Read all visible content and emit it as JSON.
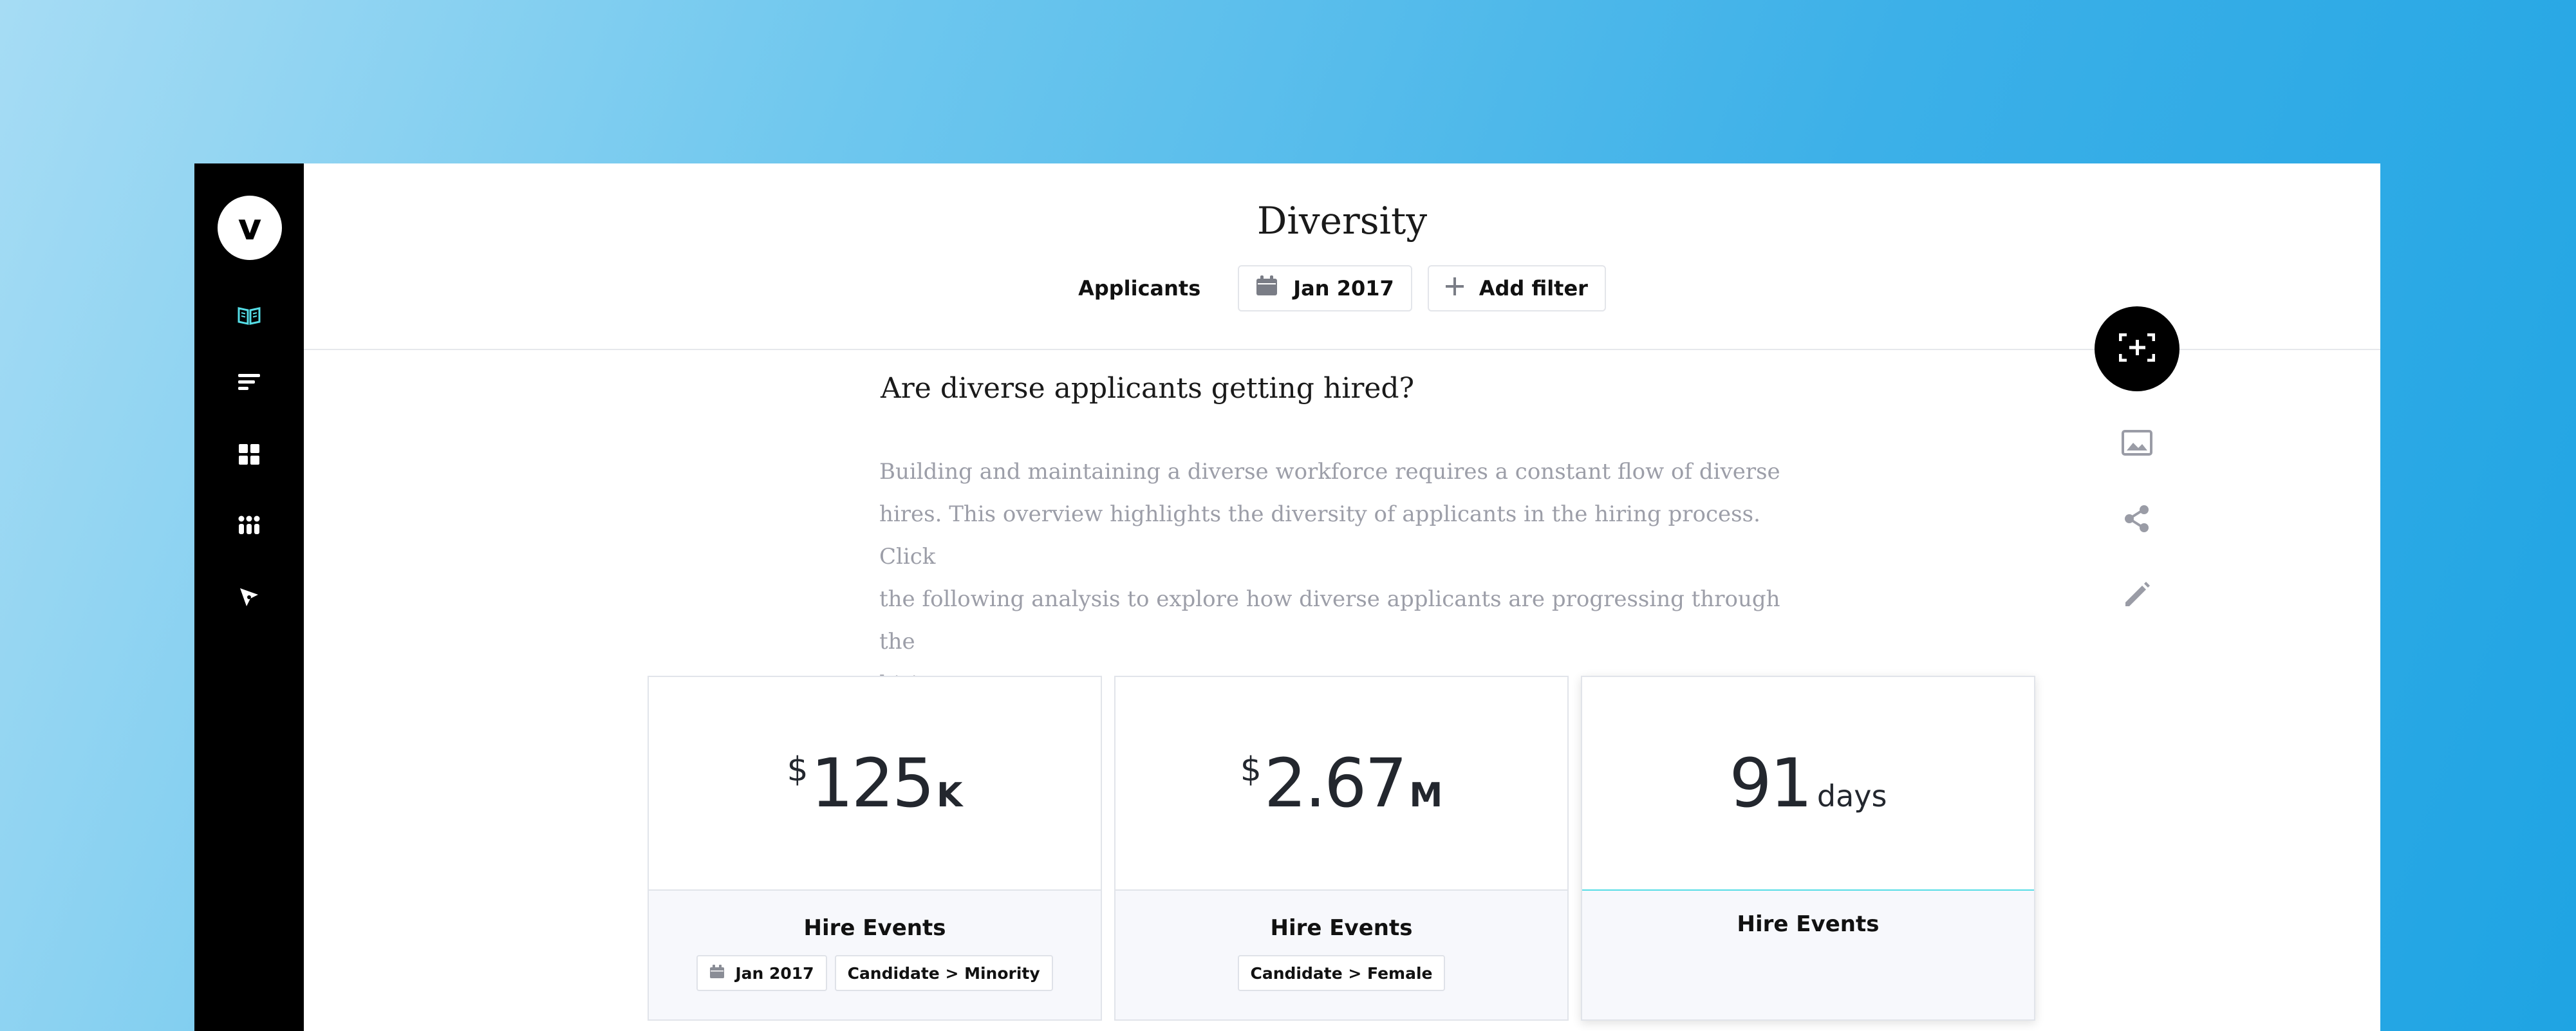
{
  "app": {
    "logo_letter": "v"
  },
  "sidebar": {
    "items": [
      {
        "icon": "book-open-icon",
        "active": true
      },
      {
        "icon": "sort-lines-icon"
      },
      {
        "icon": "grid-icon"
      },
      {
        "icon": "apps-dots-icon"
      },
      {
        "icon": "compass-icon"
      }
    ]
  },
  "header": {
    "title": "Diversity",
    "filter_label": "Applicants",
    "date_chip": "Jan 2017",
    "add_filter_label": "Add filter"
  },
  "content": {
    "question": "Are diverse applicants getting hired?",
    "description_lines": [
      "Building and maintaining a diverse workforce requires a constant flow of diverse",
      "hires. This overview highlights the diversity of applicants in the hiring process. Click",
      "the following analysis to explore how diverse applicants are progressing through the",
      "hiring process."
    ]
  },
  "actions": {
    "fab_icon": "add-frame-icon",
    "items": [
      "image-icon",
      "share-icon",
      "edit-pencil-icon"
    ]
  },
  "cards": [
    {
      "metric": {
        "prefix": "$",
        "value": "125",
        "suffix": "K"
      },
      "title": "Hire Events",
      "chips": [
        {
          "icon": "calendar-icon",
          "label": "Jan 2017"
        },
        {
          "label": "Candidate > Minority"
        }
      ]
    },
    {
      "metric": {
        "prefix": "$",
        "value": "2.67",
        "suffix": "M"
      },
      "title": "Hire Events",
      "chips": [
        {
          "label": "Candidate > Female"
        }
      ]
    },
    {
      "metric": {
        "prefix": "",
        "value": "91",
        "suffix": "days"
      },
      "title": "Hire Events",
      "chips": [],
      "active": true
    }
  ],
  "colors": {
    "accent": "#55dde6",
    "sidebar_bg": "#000000",
    "description_text": "#9c9ea8",
    "card_footer_bg": "#f7f8fc"
  }
}
